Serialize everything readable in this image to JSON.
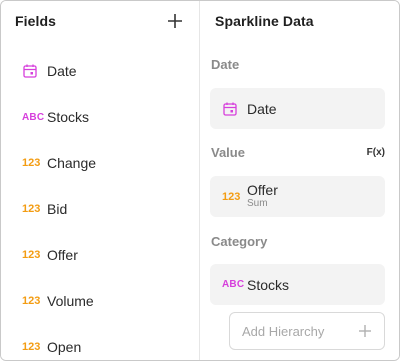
{
  "fields_panel": {
    "title": "Fields",
    "add_icon": "plus-icon",
    "items": [
      {
        "icon": "calendar-icon",
        "type_text": "",
        "label": "Date"
      },
      {
        "icon": "abc-icon",
        "type_text": "ABC",
        "label": "Stocks"
      },
      {
        "icon": "number-icon",
        "type_text": "123",
        "label": "Change"
      },
      {
        "icon": "number-icon",
        "type_text": "123",
        "label": "Bid"
      },
      {
        "icon": "number-icon",
        "type_text": "123",
        "label": "Offer"
      },
      {
        "icon": "number-icon",
        "type_text": "123",
        "label": "Volume"
      },
      {
        "icon": "number-icon",
        "type_text": "123",
        "label": "Open"
      }
    ]
  },
  "sparkline_panel": {
    "title": "Sparkline Data",
    "date_section": {
      "label": "Date",
      "field": {
        "icon": "calendar-icon",
        "label": "Date"
      }
    },
    "value_section": {
      "label": "Value",
      "fx_label": "F(x)",
      "field": {
        "icon": "number-icon",
        "type_text": "123",
        "label": "Offer",
        "aggregation": "Sum"
      }
    },
    "category_section": {
      "label": "Category",
      "field": {
        "icon": "abc-icon",
        "type_text": "ABC",
        "label": "Stocks"
      }
    },
    "add_hierarchy": {
      "label": "Add Hierarchy",
      "icon": "plus-icon"
    }
  },
  "colors": {
    "number_type": "#f39c12",
    "text_type": "#d63fdc",
    "date_type": "#d63fdc",
    "card_bg": "#f3f3f3"
  }
}
